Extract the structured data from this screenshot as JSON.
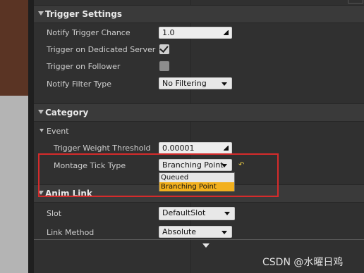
{
  "sections": {
    "trigger_settings": "Trigger Settings",
    "category": "Category",
    "anim_link": "Anim Link"
  },
  "rows": {
    "notify_trigger_chance": {
      "label": "Notify Trigger Chance",
      "value": "1.0"
    },
    "trigger_dedicated_server": {
      "label": "Trigger on Dedicated Server",
      "checked": true
    },
    "trigger_follower": {
      "label": "Trigger on Follower",
      "checked": false
    },
    "notify_filter_type": {
      "label": "Notify Filter Type",
      "value": "No Filtering"
    },
    "event": {
      "label": "Event"
    },
    "trigger_weight_threshold": {
      "label": "Trigger Weight Threshold",
      "value": "0.00001"
    },
    "montage_tick_type": {
      "label": "Montage Tick Type",
      "value": "Branching Point"
    },
    "slot": {
      "label": "Slot",
      "value": "DefaultSlot"
    },
    "link_method": {
      "label": "Link Method",
      "value": "Absolute"
    }
  },
  "dropdown": {
    "options": [
      "Queued",
      "Branching Point"
    ],
    "selected": "Branching Point"
  },
  "watermark": "CSDN @水曜日鸡",
  "colors": {
    "panel": "#303030",
    "section_header": "#3a3a3a",
    "highlight_box": "#d62b2b",
    "dropdown_selected": "#f2b01e",
    "reset_icon": "#e3c542"
  }
}
